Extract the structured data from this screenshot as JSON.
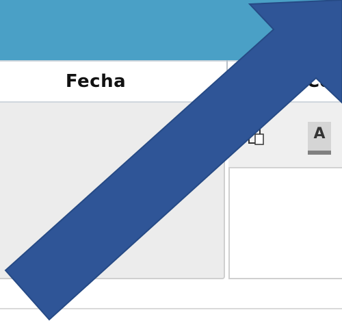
{
  "table": {
    "columns": [
      "Fecha",
      "Co"
    ]
  },
  "toolbar": {
    "paste_icon": "paste-icon",
    "font_color_icon": "font-color-icon",
    "font_color_glyph": "A"
  },
  "overlay": {
    "arrow_icon": "annotation-arrow-icon",
    "arrow_color": "#2f5597"
  },
  "colors": {
    "titlebar": "#4aa0c6",
    "panel": "#ececec"
  }
}
